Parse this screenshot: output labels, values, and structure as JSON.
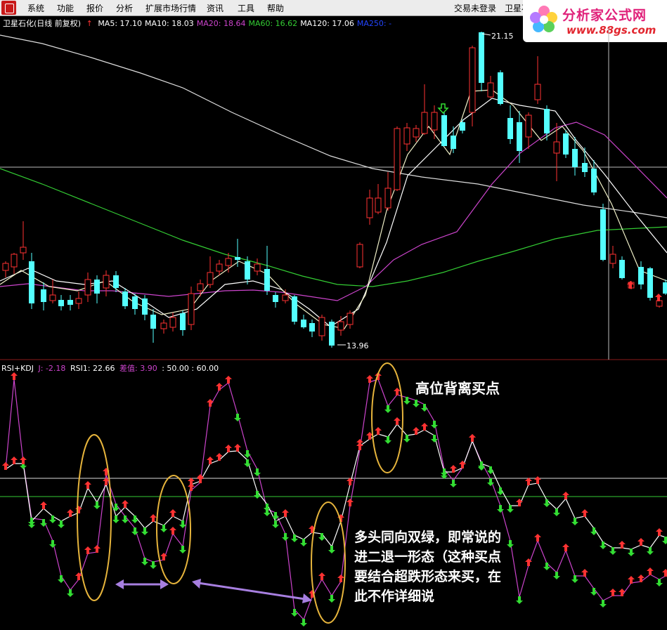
{
  "menu": {
    "items": [
      "系统",
      "功能",
      "报价",
      "分析",
      "扩展市场行情",
      "资讯",
      "工具",
      "帮助"
    ],
    "login_status": "交易未登录",
    "stock_short": "卫星石"
  },
  "watermark": {
    "title": "分析家公式网",
    "url": "www.88gs.com"
  },
  "main_chart": {
    "stock_name": "卫星石化(日线 前复权)",
    "ma_labels": [
      {
        "text": "MA5: 17.10",
        "color": "#ffffff"
      },
      {
        "text": "MA10: 18.03",
        "color": "#ffffff"
      },
      {
        "text": "MA20: 18.64",
        "color": "#cc44cc"
      },
      {
        "text": "MA60: 16.62",
        "color": "#33cc33"
      },
      {
        "text": "MA120: 17.06",
        "color": "#ffffff"
      },
      {
        "text": "MA250: -",
        "color": "#2244ff"
      }
    ],
    "high_label": "21.15",
    "low_label": "13.96"
  },
  "sub_chart": {
    "indicator_name": "RSI+KDJ",
    "j_label": "J: -2.18",
    "rsi_label": "RSI1: 22.66",
    "diff_label": "差值: 3.90",
    "level_label": ": 50.00 : 60.00"
  },
  "annotations": {
    "top": "高位背离买点",
    "bottom": "多头同向双绿，即常说的进二退一形态（这种买点要结合超跌形态来买，在此不作详细说"
  },
  "colors": {
    "up_candle": "#ff3232",
    "down_candle": "#54ffff",
    "ma20": "#cc44cc",
    "ma60": "#33cc33",
    "rsi_line": "#ffffff",
    "kdj_line": "#cc44cc",
    "highlight_ellipse": "#e6b43c",
    "arrow": "#a77fe0",
    "up_marker": "#ff3232",
    "down_marker": "#33dd33"
  }
}
